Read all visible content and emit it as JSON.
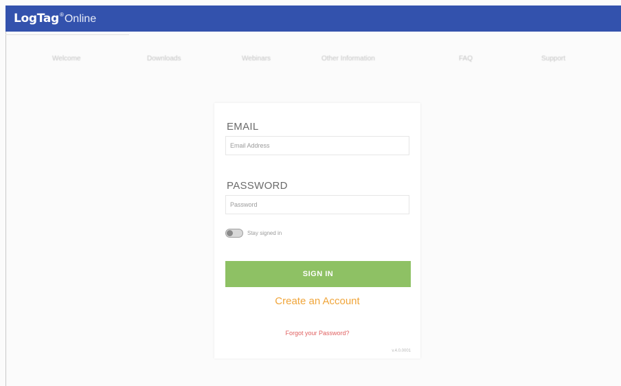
{
  "header": {
    "brand_main": "LogTag",
    "brand_mark": "®",
    "brand_sub": "Online",
    "bar_color": "#3352ad"
  },
  "nav": {
    "items": [
      {
        "label": "Welcome"
      },
      {
        "label": "Downloads"
      },
      {
        "label": "Webinars"
      },
      {
        "label": "Other Information"
      },
      {
        "label": "FAQ"
      },
      {
        "label": "Support"
      }
    ]
  },
  "login": {
    "email_label": "EMAIL",
    "email_placeholder": "Email Address",
    "password_label": "PASSWORD",
    "password_placeholder": "Password",
    "remember_label": "Stay signed in",
    "signin_label": "SIGN IN",
    "signin_color": "#8ec164",
    "create_account_label": "Create an Account",
    "forgot_password_label": "Forgot your Password?",
    "version_text": "v.4.0.0001"
  }
}
